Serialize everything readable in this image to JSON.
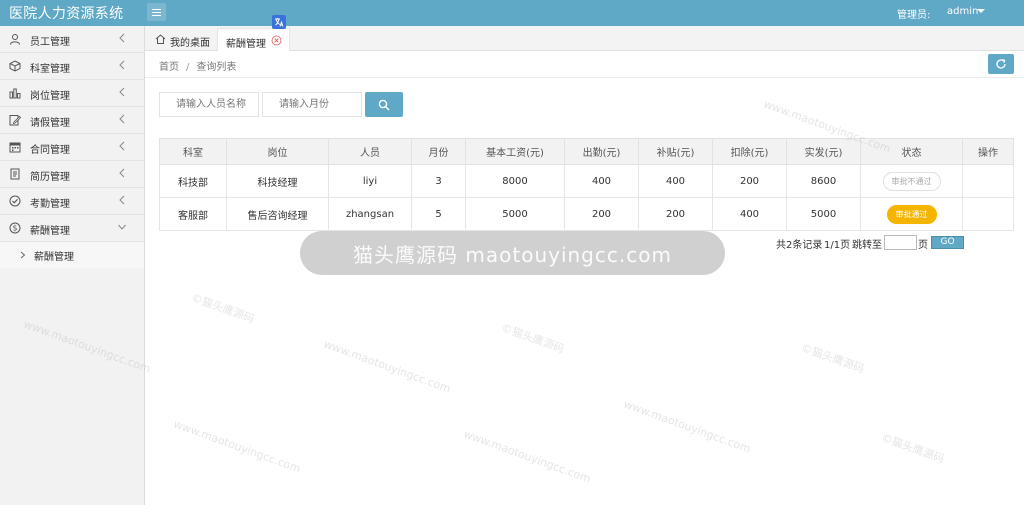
{
  "app": {
    "title": "医院人力资源系统"
  },
  "header": {
    "admin_label": "管理员:",
    "admin_user": "admin"
  },
  "sidebar": {
    "items": [
      {
        "label": "员工管理",
        "icon": "user-icon"
      },
      {
        "label": "科室管理",
        "icon": "cube-icon"
      },
      {
        "label": "岗位管理",
        "icon": "chart-icon"
      },
      {
        "label": "请假管理",
        "icon": "edit-icon"
      },
      {
        "label": "合同管理",
        "icon": "calendar-icon"
      },
      {
        "label": "简历管理",
        "icon": "document-icon"
      },
      {
        "label": "考勤管理",
        "icon": "check-circle-icon"
      },
      {
        "label": "薪酬管理",
        "icon": "dollar-icon",
        "expanded": true
      }
    ],
    "sub_items": [
      {
        "label": "薪酬管理"
      }
    ]
  },
  "tabs": [
    {
      "label": "我的桌面"
    },
    {
      "label": "薪酬管理",
      "active": true
    }
  ],
  "breadcrumb": {
    "home": "首页",
    "separator": "/",
    "current": "查询列表"
  },
  "search": {
    "name_placeholder": "请输入人员名称",
    "month_placeholder": "请输入月份"
  },
  "table": {
    "headers": [
      "科室",
      "岗位",
      "人员",
      "月份",
      "基本工资(元)",
      "出勤(元)",
      "补贴(元)",
      "扣除(元)",
      "实发(元)",
      "状态",
      "操作"
    ],
    "rows": [
      [
        "科技部",
        "科技经理",
        "liyi",
        "3",
        "8000",
        "400",
        "400",
        "200",
        "8600",
        "审批不通过",
        ""
      ],
      [
        "客服部",
        "售后咨询经理",
        "zhangsan",
        "5",
        "5000",
        "200",
        "200",
        "400",
        "5000",
        "审批通过",
        ""
      ]
    ]
  },
  "pager": {
    "total": "共2条记录",
    "pages": "1/1页",
    "jump_label": "跳转至",
    "page_suffix": "页",
    "go_label": "GO"
  },
  "watermark": {
    "banner": "猫头鹰源码 maotouyingcc.com",
    "repeat_line1": "©猫头鹰源码",
    "repeat_line2": "www.maotouyingcc.com"
  },
  "colors": {
    "primary": "#5fa8c6",
    "status_pass": "#f5b400",
    "sidebar_bg": "#f2f2f2"
  }
}
